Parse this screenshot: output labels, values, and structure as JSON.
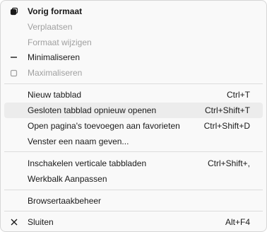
{
  "window_menu": {
    "restore": {
      "label": "Vorig formaat",
      "icon": "restore-icon"
    },
    "move": {
      "label": "Verplaatsen"
    },
    "size": {
      "label": "Formaat wijzigen"
    },
    "minimize": {
      "label": "Minimaliseren",
      "icon": "minimize-icon"
    },
    "maximize": {
      "label": "Maximaliseren",
      "icon": "maximize-icon"
    }
  },
  "tab_menu": {
    "new_tab": {
      "label": "Nieuw tabblad",
      "shortcut": "Ctrl+T"
    },
    "reopen_tab": {
      "label": "Gesloten tabblad opnieuw openen",
      "shortcut": "Ctrl+Shift+T"
    },
    "add_favorites": {
      "label": "Open pagina's toevoegen aan favorieten",
      "shortcut": "Ctrl+Shift+D"
    },
    "name_window": {
      "label": "Venster een naam geven..."
    }
  },
  "view_menu": {
    "vertical_tabs": {
      "label": "Inschakelen verticale tabbladen",
      "shortcut": "Ctrl+Shift+,"
    },
    "customize_toolbar": {
      "label": "Werkbalk Aanpassen"
    }
  },
  "tools_menu": {
    "task_manager": {
      "label": "Browsertaakbeheer"
    }
  },
  "close_menu": {
    "close": {
      "label": "Sluiten",
      "shortcut": "Alt+F4",
      "icon": "close-icon"
    }
  },
  "colors": {
    "hover": "#ececec",
    "disabled_text": "#a0a0a0"
  }
}
